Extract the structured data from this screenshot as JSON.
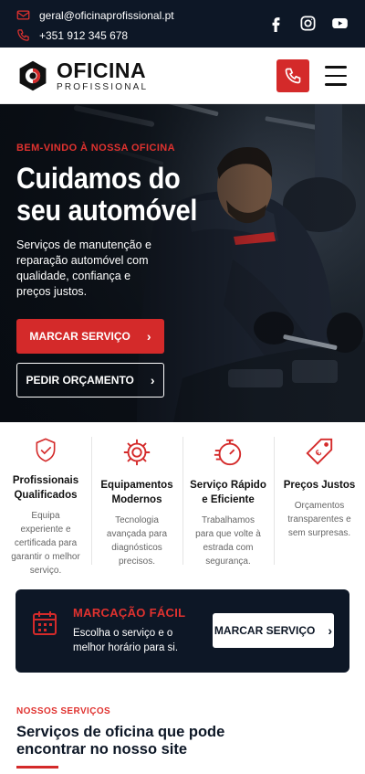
{
  "topbar": {
    "email": "geral@oficinaprofissional.pt",
    "phone": "+351 912 345 678",
    "socials": [
      "facebook-icon",
      "instagram-icon",
      "youtube-icon"
    ]
  },
  "header": {
    "logo_word1": "OFICINA",
    "logo_word2": "PROFISSIONAL"
  },
  "hero": {
    "kicker": "BEM-VINDO À NOSSA OFICINA",
    "title_line1": "Cuidamos do",
    "title_line2": "seu automóvel",
    "description": "Serviços de manutenção e reparação automóvel com qualidade, confiança e preços justos.",
    "primary_button": "MARCAR SERVIÇO",
    "secondary_button": "PEDIR ORÇAMENTO"
  },
  "features": [
    {
      "icon": "shield-check-icon",
      "title_1": "Profissionais",
      "title_2": "Qualificados",
      "desc": "Equipa experiente e certificada para garantir o melhor serviço."
    },
    {
      "icon": "gear-icon",
      "title_1": "Equipamentos",
      "title_2": "Modernos",
      "desc": "Tecnologia avançada para diagnósticos precisos."
    },
    {
      "icon": "stopwatch-icon",
      "title_1": "Serviço Rápido",
      "title_2": "e Eficiente",
      "desc": "Trabalhamos para que volte à estrada com segurança."
    },
    {
      "icon": "euro-tag-icon",
      "title_1": "Preços Justos",
      "title_2": "",
      "desc": "Orçamentos transparentes e sem surpresas."
    }
  ],
  "booking": {
    "title": "MARCAÇÃO FÁCIL",
    "description": "Escolha o serviço e o melhor horário para si.",
    "button": "MARCAR SERVIÇO"
  },
  "services": {
    "kicker": "NOSSOS SERVIÇOS",
    "heading": "Serviços de oficina que pode encontrar no nosso site"
  },
  "colors": {
    "navy": "#0d1726",
    "accent_red": "#d42a2a"
  }
}
